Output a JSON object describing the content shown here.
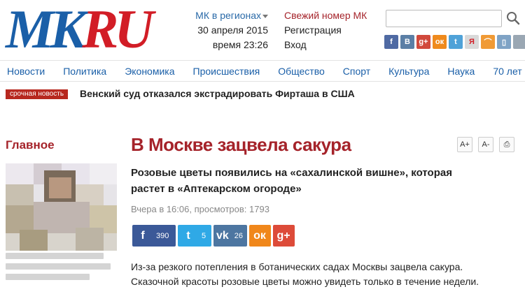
{
  "logo": {
    "part1": "MK",
    "part2": "RU"
  },
  "header": {
    "region": "МК в регионах",
    "date": "30 апреля 2015",
    "time": "время 23:26",
    "fresh_issue": "Свежий номер МК",
    "register": "Регистрация",
    "login": "Вход",
    "search_placeholder": ""
  },
  "socials": [
    {
      "name": "facebook-icon",
      "glyph": "f",
      "color": "#4f6aa3"
    },
    {
      "name": "vkontakte-icon",
      "glyph": "В",
      "color": "#5b7fa6"
    },
    {
      "name": "googleplus-icon",
      "glyph": "g+",
      "color": "#d1493c"
    },
    {
      "name": "odnoklassniki-icon",
      "glyph": "ок",
      "color": "#ef8a1d"
    },
    {
      "name": "twitter-icon",
      "glyph": "t",
      "color": "#4fa2d8"
    },
    {
      "name": "yandex-icon",
      "glyph": "Я",
      "color": "#d9d9d9"
    },
    {
      "name": "rss-icon",
      "glyph": "⌒",
      "color": "#f09a35"
    },
    {
      "name": "mobile-icon",
      "glyph": "▯",
      "color": "#7fa3c5"
    },
    {
      "name": "apple-icon",
      "glyph": "",
      "color": "#9aa7b3"
    },
    {
      "name": "windows-icon",
      "glyph": "⊞",
      "color": "#8ba7c3"
    }
  ],
  "nav": [
    "Новости",
    "Политика",
    "Экономика",
    "Происшествия",
    "Общество",
    "Спорт",
    "Культура",
    "Наука",
    "70 лет"
  ],
  "breaking": {
    "label": "срочная новость",
    "text": "Венский суд отказался экстрадировать Фирташа в США"
  },
  "sidebar": {
    "main_label": "Главное"
  },
  "article": {
    "title": "В Москве зацвела сакура",
    "lead": "Розовые цветы появились на «сахалинской вишне», которая растет в «Аптекарском огороде»",
    "meta": "Вчера в 16:06, просмотров: 1793",
    "body": "Из-за резкого потепления в ботанических садах Москвы зацвела сакура. Сказочной красоты розовые цветы можно увидеть только в течение недели."
  },
  "tools": {
    "font_up": "A+",
    "font_down": "A-",
    "print": "⎙"
  },
  "shares": [
    {
      "name": "facebook-share",
      "glyph": "f",
      "count": "390",
      "color": "#3b5998"
    },
    {
      "name": "twitter-share",
      "glyph": "t",
      "count": "5",
      "color": "#2fa9e6"
    },
    {
      "name": "vkontakte-share",
      "glyph": "vk",
      "count": "26",
      "color": "#4d76a1"
    },
    {
      "name": "odnoklassniki-share",
      "glyph": "ок",
      "count": "",
      "color": "#f0871b"
    },
    {
      "name": "googleplus-share",
      "glyph": "g+",
      "count": "",
      "color": "#dd4b39"
    }
  ]
}
